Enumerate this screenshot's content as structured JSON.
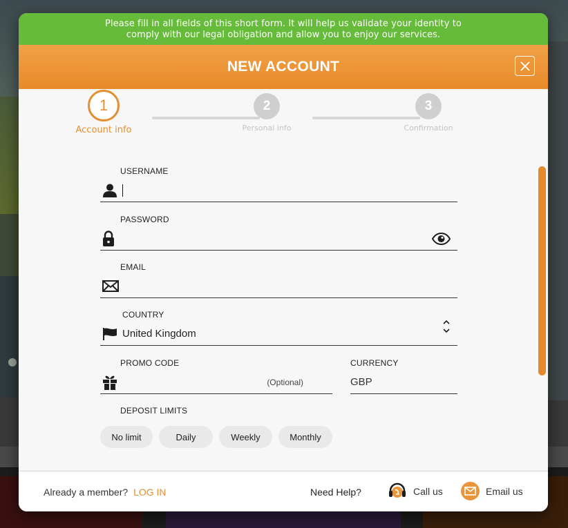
{
  "notice": {
    "line1": "Please fill in all fields of this short form. It will help us validate your identity to",
    "line2": "comply with our legal obligation and allow you to enjoy our services."
  },
  "header": {
    "title": "NEW ACCOUNT"
  },
  "steps": [
    {
      "number": "1",
      "label": "Account info",
      "state": "active"
    },
    {
      "number": "2",
      "label": "Personal info",
      "state": "inactive"
    },
    {
      "number": "3",
      "label": "Confirmation",
      "state": "inactive"
    }
  ],
  "form": {
    "username": {
      "label": "USERNAME",
      "value": "",
      "icon": "user-icon"
    },
    "password": {
      "label": "PASSWORD",
      "value": "",
      "icon": "lock-icon",
      "toggle_icon": "eye-icon"
    },
    "email": {
      "label": "EMAIL",
      "value": "",
      "icon": "envelope-icon"
    },
    "country": {
      "label": "COUNTRY",
      "value": "United Kingdom",
      "icon": "flag-icon"
    },
    "promo": {
      "label": "PROMO CODE",
      "optional": "(Optional)",
      "value": "",
      "icon": "gift-icon"
    },
    "currency": {
      "label": "CURRENCY",
      "value": "GBP"
    },
    "deposit_limits": {
      "label": "DEPOSIT LIMITS",
      "options": [
        "No limit",
        "Daily",
        "Weekly",
        "Monthly"
      ]
    }
  },
  "footer": {
    "member_text": "Already a member?",
    "login_label": "LOG IN",
    "help_text": "Need Help?",
    "call_label": "Call us",
    "email_label": "Email us"
  },
  "colors": {
    "notice_green": "#66bb3a",
    "header_orange": "#e88a2a",
    "accent_orange": "#e38f33",
    "step_inactive": "#cfcfcf"
  }
}
